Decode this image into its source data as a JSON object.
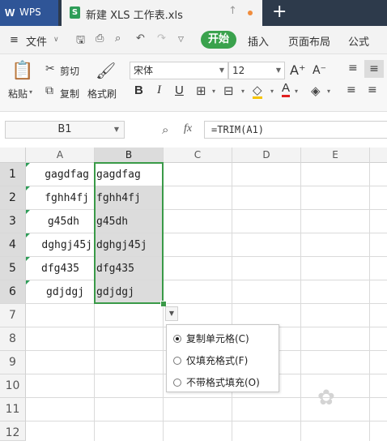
{
  "tabs": {
    "wps": "WPS",
    "file": "新建 XLS 工作表.xls"
  },
  "menu": {
    "file": "文件",
    "start": "开始",
    "insert": "插入",
    "page_layout": "页面布局",
    "formula": "公式"
  },
  "ribbon": {
    "paste": "粘贴",
    "cut": "剪切",
    "copy": "复制",
    "format_painter": "格式刷",
    "font_name": "宋体",
    "font_size": "12",
    "bold": "B",
    "italic": "I",
    "underline": "U"
  },
  "formula_bar": {
    "name_box": "B1",
    "fx": "fx",
    "formula": "=TRIM(A1)"
  },
  "grid": {
    "columns": [
      "A",
      "B",
      "C",
      "D",
      "E"
    ],
    "rows": [
      "1",
      "2",
      "3",
      "4",
      "5",
      "6",
      "7",
      "8",
      "9",
      "10",
      "11",
      "12"
    ],
    "cells_a": [
      "gagdfag",
      "fghh4fj",
      "g45dh",
      "dghgj45j",
      "dfg435",
      "gdjdgj"
    ],
    "cells_b": [
      "gagdfag",
      "fghh4fj",
      "g45dh",
      "dghgj45j",
      "dfg435",
      "gdjdgj"
    ]
  },
  "autofill_menu": {
    "options": [
      "复制单元格(C)",
      "仅填充格式(F)",
      "不带格式填充(O)"
    ],
    "selected": 0
  },
  "colors": {
    "accent_green": "#3aa24d",
    "selection_border": "#3a9a48",
    "title_bar": "#2d3a4b"
  }
}
